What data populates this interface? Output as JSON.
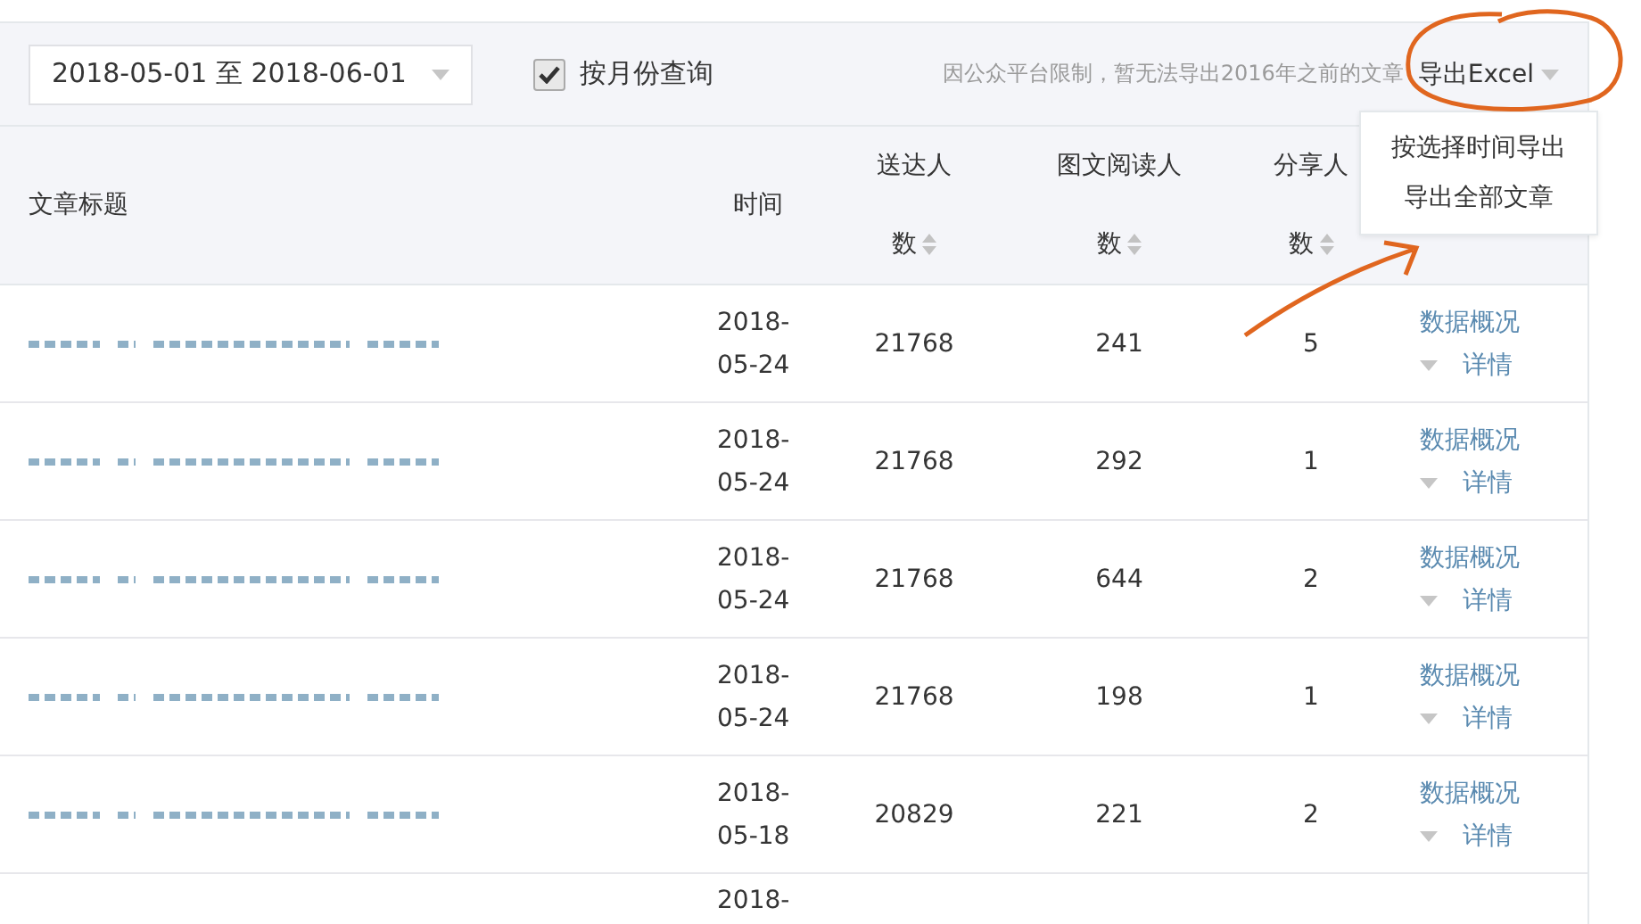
{
  "toolbar": {
    "date_range": "2018-05-01 至 2018-06-01",
    "monthly_query": {
      "label": "按月份查询",
      "checked": true
    },
    "notice": "因公众平台限制，暂无法导出2016年之前的文章",
    "export_button": "导出Excel"
  },
  "export_menu": {
    "items": [
      {
        "label": "按选择时间导出"
      },
      {
        "label": "导出全部文章"
      }
    ]
  },
  "table": {
    "columns": [
      {
        "label": "文章标题",
        "sortable": false
      },
      {
        "label": "时间",
        "sortable": false
      },
      {
        "label": "送达人数",
        "sortable": true
      },
      {
        "label": "图文阅读人数",
        "sortable": true
      },
      {
        "label": "分享人数",
        "sortable": true
      }
    ],
    "rows": [
      {
        "time": "2018-05-24",
        "delivered": "21768",
        "readers": "241",
        "shares": "5",
        "overview": "数据概况",
        "details": "详情"
      },
      {
        "time": "2018-05-24",
        "delivered": "21768",
        "readers": "292",
        "shares": "1",
        "overview": "数据概况",
        "details": "详情"
      },
      {
        "time": "2018-05-24",
        "delivered": "21768",
        "readers": "644",
        "shares": "2",
        "overview": "数据概况",
        "details": "详情"
      },
      {
        "time": "2018-05-24",
        "delivered": "21768",
        "readers": "198",
        "shares": "1",
        "overview": "数据概况",
        "details": "详情"
      },
      {
        "time": "2018-05-18",
        "delivered": "20829",
        "readers": "221",
        "shares": "2",
        "overview": "数据概况",
        "details": "详情"
      },
      {
        "time": "2018-"
      }
    ]
  }
}
